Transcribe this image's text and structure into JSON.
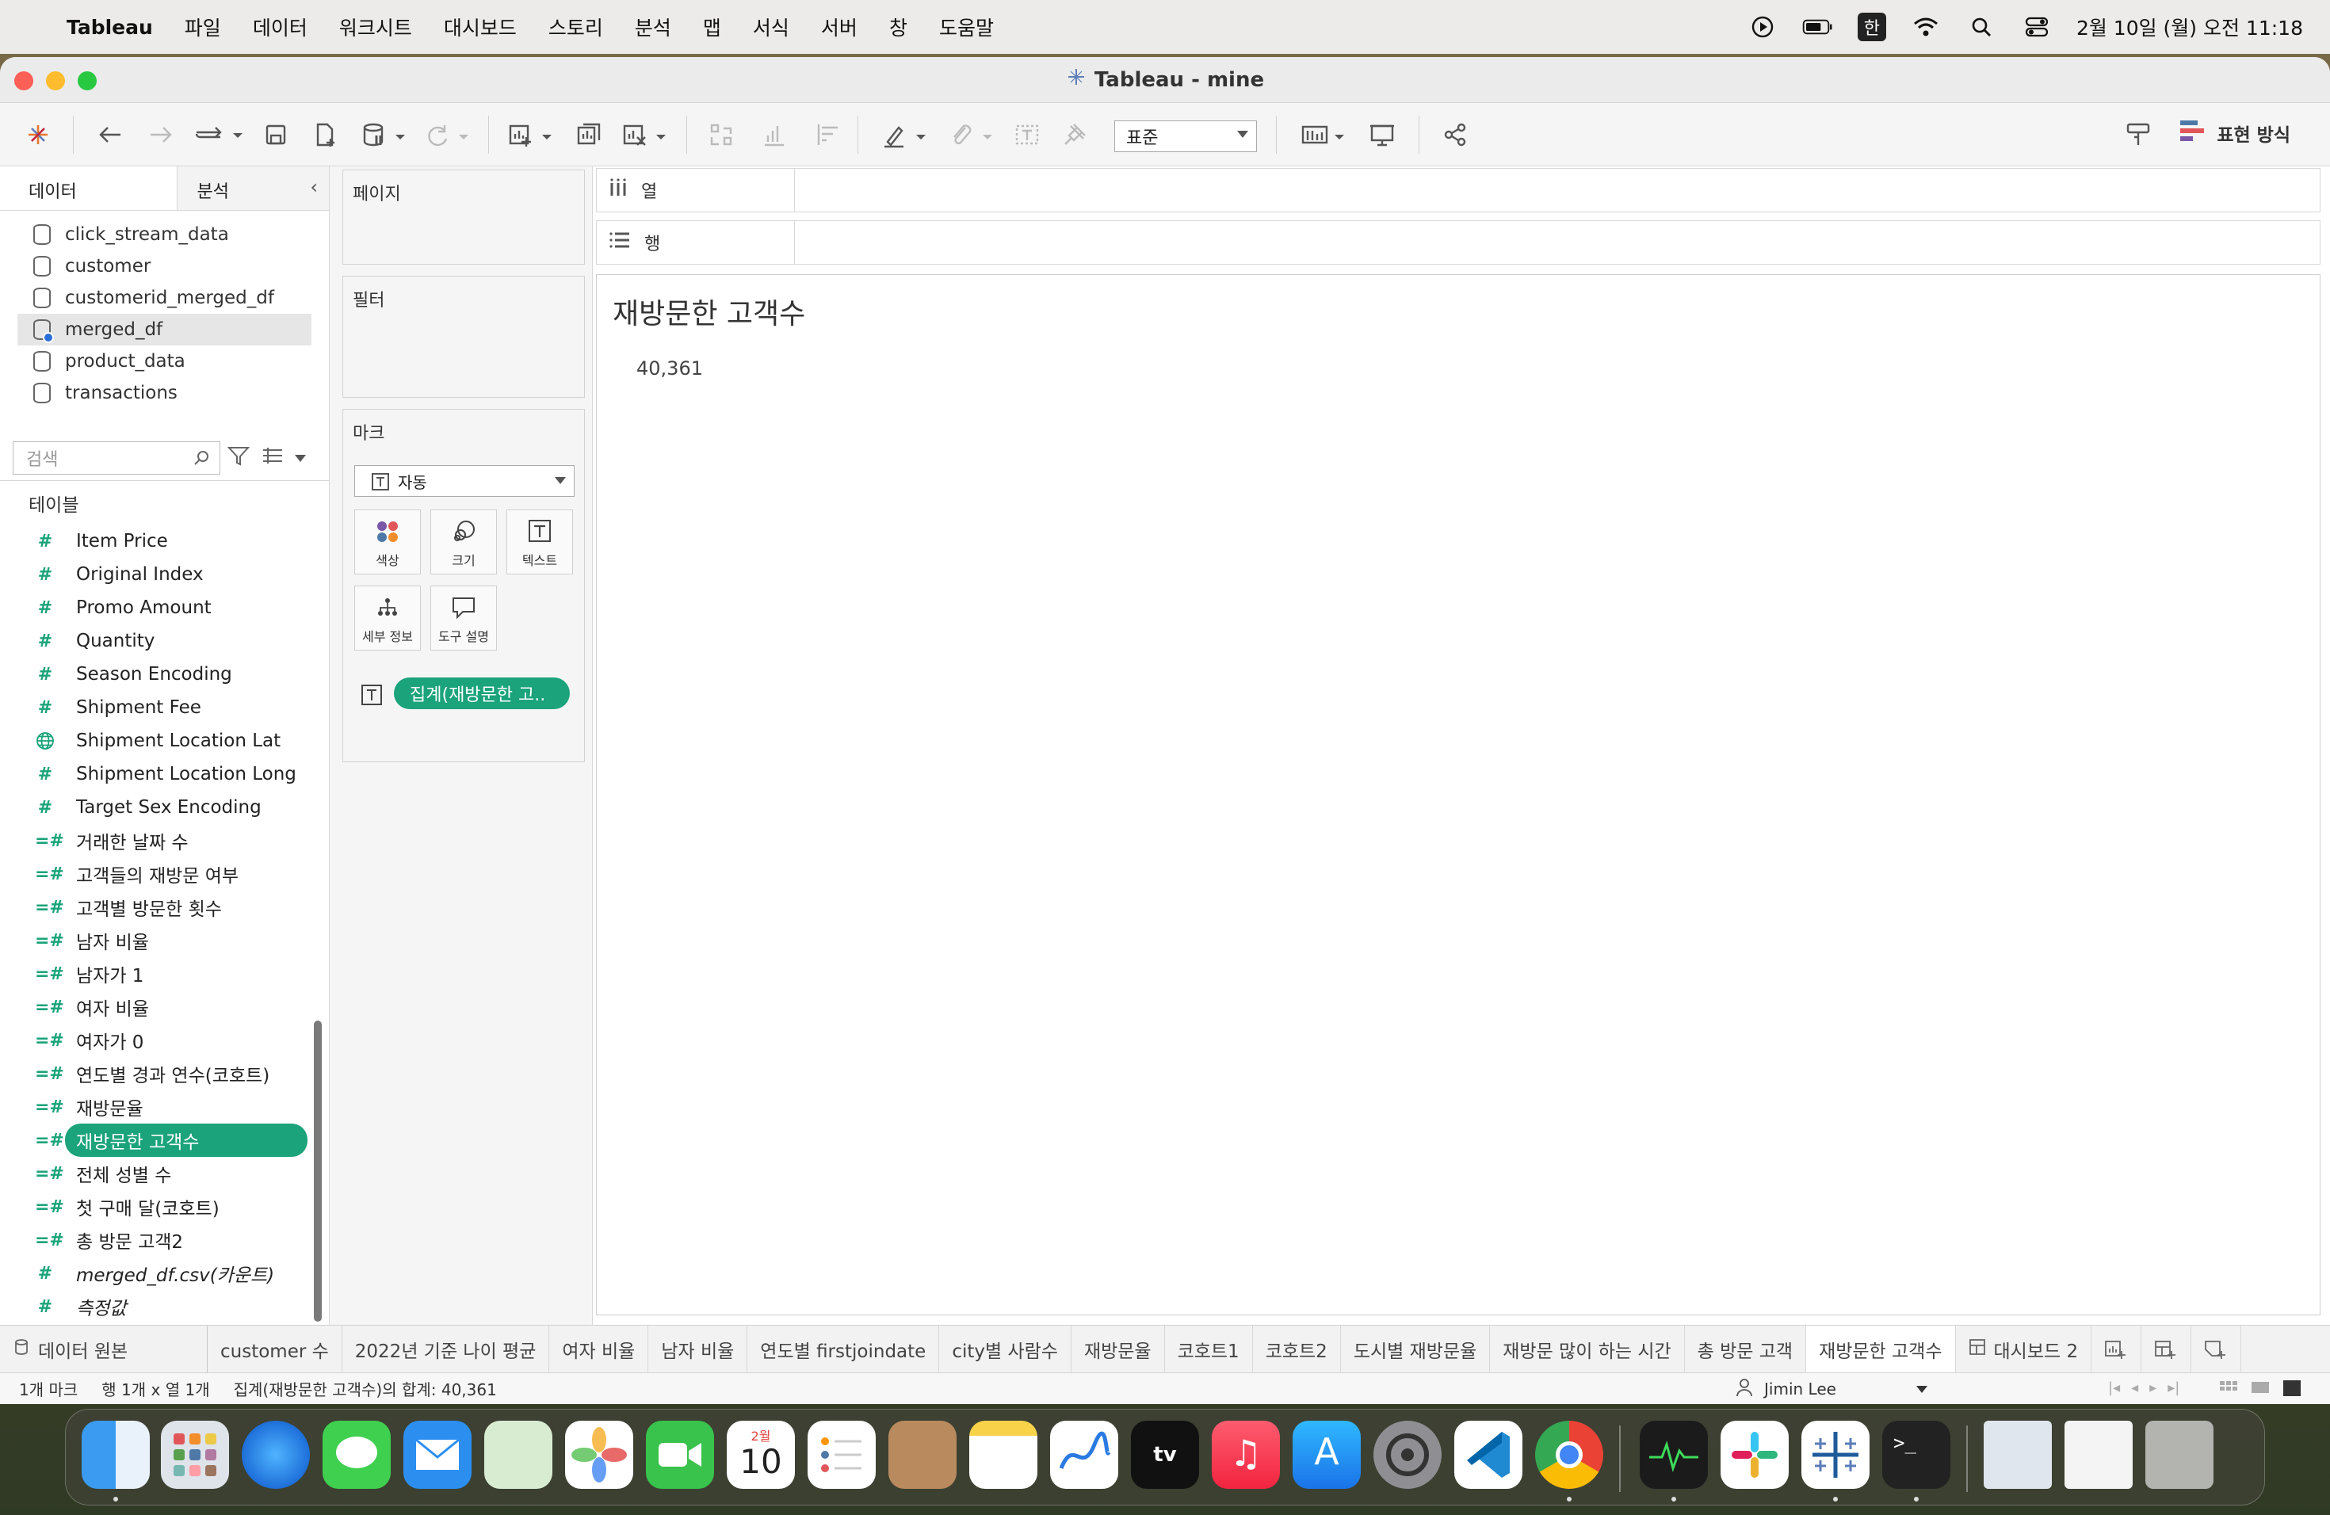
{
  "menubar": {
    "app": "Tableau",
    "items": [
      "파일",
      "데이터",
      "워크시트",
      "대시보드",
      "스토리",
      "분석",
      "맵",
      "서식",
      "서버",
      "창",
      "도움말"
    ],
    "input_source": "한",
    "clock": "2월 10일 (월) 오전 11:18"
  },
  "window": {
    "title": "Tableau - mine"
  },
  "toolbar": {
    "fit_select": "표준",
    "show_me": "표현 방식"
  },
  "data_pane": {
    "tabs": [
      "데이터",
      "분석"
    ],
    "datasources": [
      {
        "name": "click_stream_data",
        "selected": false
      },
      {
        "name": "customer",
        "selected": false
      },
      {
        "name": "customerid_merged_df",
        "selected": false
      },
      {
        "name": "merged_df",
        "selected": true
      },
      {
        "name": "product_data",
        "selected": false
      },
      {
        "name": "transactions",
        "selected": false
      }
    ],
    "search_placeholder": "검색",
    "tables_label": "테이블",
    "fields": [
      {
        "name": "Item Price",
        "icon": "measure-hash-icon"
      },
      {
        "name": "Original Index",
        "icon": "measure-hash-icon"
      },
      {
        "name": "Promo Amount",
        "icon": "measure-hash-icon"
      },
      {
        "name": "Quantity",
        "icon": "measure-hash-icon"
      },
      {
        "name": "Season Encoding",
        "icon": "measure-hash-icon"
      },
      {
        "name": "Shipment Fee",
        "icon": "measure-hash-icon"
      },
      {
        "name": "Shipment Location Lat",
        "icon": "globe-icon"
      },
      {
        "name": "Shipment Location Long",
        "icon": "measure-hash-icon"
      },
      {
        "name": "Target Sex Encoding",
        "icon": "measure-hash-icon"
      },
      {
        "name": "거래한 날짜 수",
        "icon": "calc-hash-icon"
      },
      {
        "name": "고객들의 재방문 여부",
        "icon": "calc-hash-icon"
      },
      {
        "name": "고객별 방문한 횟수",
        "icon": "calc-hash-icon"
      },
      {
        "name": "남자 비율",
        "icon": "calc-hash-icon"
      },
      {
        "name": "남자가 1",
        "icon": "calc-hash-icon"
      },
      {
        "name": "여자 비율",
        "icon": "calc-hash-icon"
      },
      {
        "name": "여자가 0",
        "icon": "calc-hash-icon"
      },
      {
        "name": "연도별 경과 연수(코호트)",
        "icon": "calc-hash-icon"
      },
      {
        "name": "재방문율",
        "icon": "calc-hash-icon"
      },
      {
        "name": "재방문한 고객수",
        "icon": "calc-hash-icon"
      },
      {
        "name": "전체 성별 수",
        "icon": "calc-hash-icon"
      },
      {
        "name": "첫 구매 달(코호트)",
        "icon": "calc-hash-icon"
      },
      {
        "name": "총 방문 고객2",
        "icon": "calc-hash-icon"
      },
      {
        "name": "merged_df.csv(카운트)",
        "icon": "measure-hash-icon"
      },
      {
        "name": "측정값",
        "icon": "measure-hash-icon"
      }
    ]
  },
  "cards": {
    "pages": "페이지",
    "filters": "필터",
    "marks": "마크",
    "mark_type": "자동",
    "mark_buttons": [
      "색상",
      "크기",
      "텍스트",
      "세부 정보",
      "도구 설명"
    ],
    "mark_pill": "집계(재방문한 고.."
  },
  "shelves": {
    "columns": "열",
    "rows": "행"
  },
  "view": {
    "title": "재방문한 고객수",
    "value": "40,361"
  },
  "sheet_tabs": {
    "datasource": "데이터 원본",
    "tabs": [
      "customer 수",
      "2022년 기준 나이 평균",
      "여자 비율",
      "남자 비율",
      "연도별 firstjoindate",
      "city별 사람수",
      "재방문율",
      "코호트1",
      "코호트2",
      "도시별 재방문율",
      "재방문 많이 하는 시간",
      "총 방문 고객",
      "재방문한 고객수"
    ],
    "active": "재방문한 고객수",
    "dashboard": "대시보드 2"
  },
  "statusbar": {
    "marks": "1개 마크",
    "rows_cols": "행 1개 x 열 1개",
    "summary": "집계(재방문한 고객수)의 합계: 40,361",
    "user": "Jimin Lee"
  },
  "dock": {
    "apps": [
      "finder-icon",
      "launchpad-icon",
      "safari-icon",
      "messages-icon",
      "mail-icon",
      "maps-icon",
      "photos-icon",
      "facetime-icon",
      "calendar-icon",
      "reminders-icon",
      "contacts-icon",
      "notes-icon",
      "freeform-icon",
      "appletv-icon",
      "music-icon",
      "appstore-icon",
      "settings-icon",
      "vscode-icon",
      "chrome-icon",
      "activity-monitor-icon",
      "slack-icon",
      "tableau-icon",
      "terminal-icon",
      "recent-doc-icon",
      "recent-doc-icon",
      "trash-icon"
    ],
    "calendar_month": "2월",
    "calendar_day": "10"
  }
}
